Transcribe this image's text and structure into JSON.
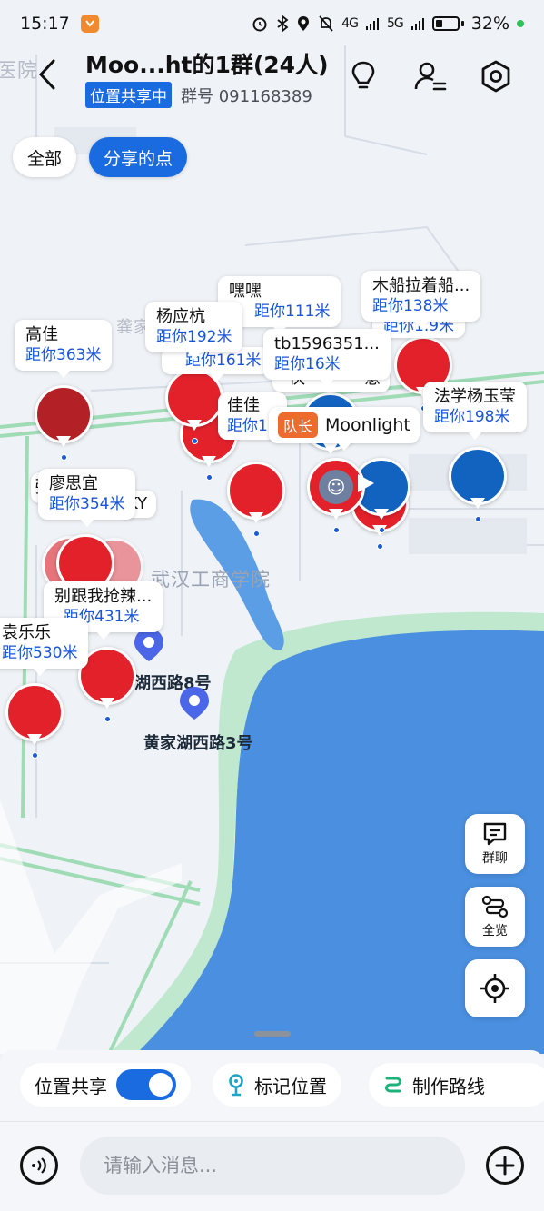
{
  "status_bar": {
    "time": "15:17",
    "signal_1": "4G",
    "signal_2": "5G",
    "battery": "32%"
  },
  "header": {
    "title": "Moo...ht的1群(24人)",
    "share_status": "位置共享中",
    "group_id": "群号 091168389"
  },
  "filters": [
    {
      "label": "全部",
      "active": false
    },
    {
      "label": "分享的点",
      "active": true
    }
  ],
  "map": {
    "place_labels": {
      "campus": "武汉工商学院",
      "road_a": "湖西路8号",
      "road_b": "黄家湖西路3号",
      "faint_gong": "龚家",
      "faint_hospital": "医院"
    },
    "members": [
      {
        "name": "嘿嘿",
        "distance": "距你111米"
      },
      {
        "name": "木船拉着船...",
        "distance": "距你138米"
      },
      {
        "name": "杨应杭",
        "distance": "距你192米"
      },
      {
        "name": "高佳",
        "distance": "距你363米"
      },
      {
        "name": "tb1596351...",
        "distance": "距你16米"
      },
      {
        "name": "法学杨玉莹",
        "distance": "距你198米"
      },
      {
        "name": "廖思宜",
        "distance": "距你354米"
      },
      {
        "name": "别跟我抢辣...",
        "distance": "距你431米"
      },
      {
        "name": "袁乐乐",
        "distance": "距你530米"
      },
      {
        "name": "",
        "distance": "距你161米"
      },
      {
        "name": "佳佳",
        "distance": "距你13"
      },
      {
        "name": "",
        "distance": "距你1.9米"
      }
    ],
    "leader": {
      "badge": "队长",
      "name": "Moonlight"
    },
    "partial_texts": {
      "ky": "KY",
      "kuai": "快",
      "yi": "意",
      "liao_left": "张",
      "right_edge": "米"
    }
  },
  "float_buttons": {
    "chat": "群聊",
    "overview": "全览"
  },
  "toolbar": {
    "share_label": "位置共享",
    "share_on": true,
    "mark_label": "标记位置",
    "route_label": "制作路线"
  },
  "composer": {
    "placeholder": "请输入消息..."
  },
  "colors": {
    "accent": "#1a6ae0",
    "pin_red": "#e3212b",
    "pin_blue": "#1263c0",
    "leader_badge": "#ee6b2e",
    "water": "#4a8fe0"
  }
}
